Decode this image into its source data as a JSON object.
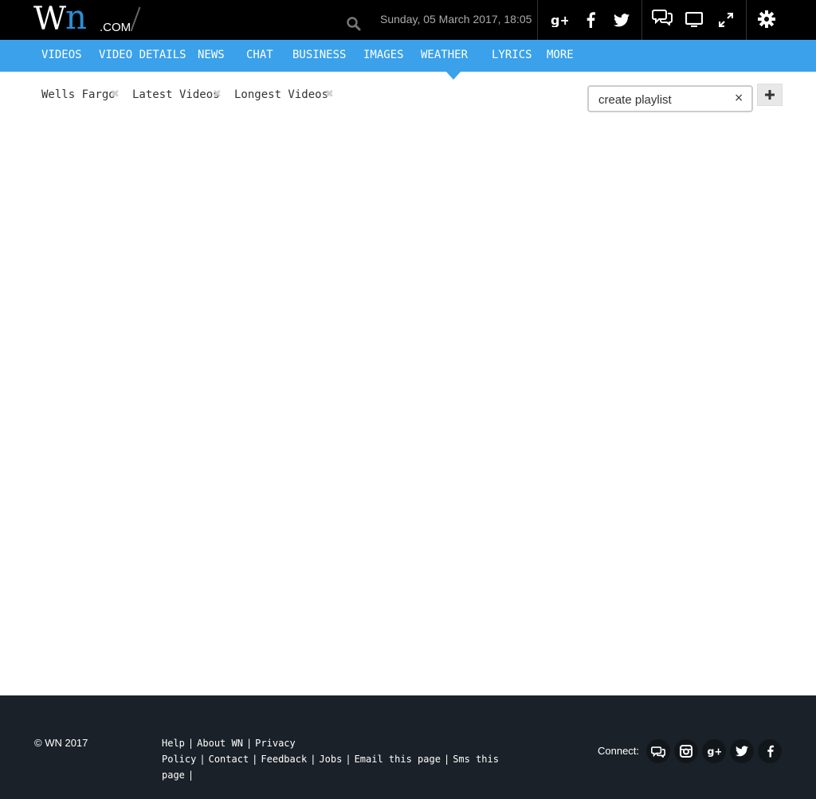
{
  "brand": {
    "logo_w": "W",
    "logo_n": "n",
    "logo_com": ".COM"
  },
  "header": {
    "date_time": "Sunday, 05 March 2017, 18:05"
  },
  "nav": {
    "items": [
      "VIDEOS",
      "VIDEO DETAILS",
      "NEWS",
      "CHAT",
      "BUSINESS",
      "IMAGES",
      "WEATHER",
      "LYRICS",
      "MORE"
    ],
    "active": "WEATHER"
  },
  "tabs": [
    {
      "label": "Wells Fargo"
    },
    {
      "label": "Latest Videos"
    },
    {
      "label": "Longest Videos"
    }
  ],
  "playlist": {
    "placeholder": "create playlist",
    "clear": "×"
  },
  "footer": {
    "copyright": "© WN 2017",
    "links": [
      "Help",
      "About WN",
      "Privacy Policy",
      "Contact",
      "Feedback",
      "Jobs",
      "Email this page",
      "Sms this page"
    ],
    "connect_label": "Connect:"
  },
  "colors": {
    "accent": "#3aa1ea",
    "logo_blue": "#2a8fd8",
    "topbar": "#000000",
    "footer": "#1b2128"
  },
  "icons": [
    "search-icon",
    "google-plus-icon",
    "facebook-icon",
    "twitter-icon",
    "chat-icon",
    "tv-icon",
    "fullscreen-icon",
    "gear-icon",
    "plus-icon",
    "instagram-icon"
  ]
}
